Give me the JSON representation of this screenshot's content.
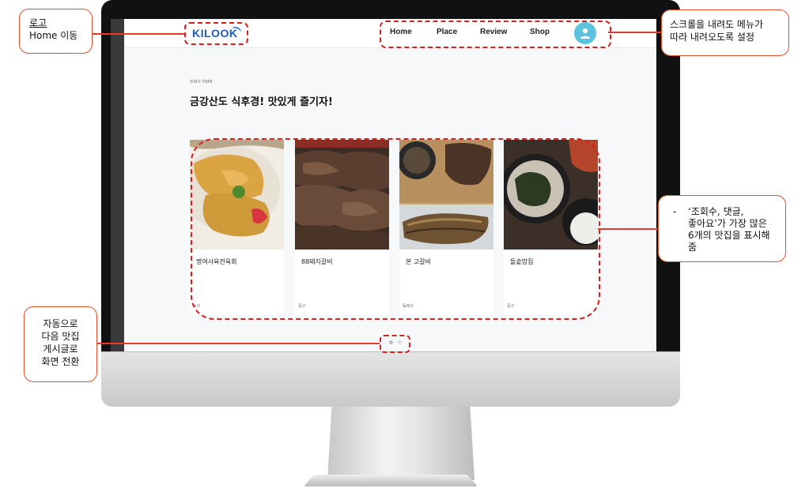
{
  "site": {
    "logo_text": "KILOOK",
    "nav_links": [
      "Home",
      "Place",
      "Review",
      "Shop"
    ]
  },
  "section": {
    "eyebrow": "조회수 TOP6",
    "title": "금강산도 식후경! 맛있게 즐기자!"
  },
  "cards": [
    {
      "name": "명여사육전육회",
      "location": "서구"
    },
    {
      "name": "88돼지갈비",
      "location": "중구"
    },
    {
      "name": "본 고갈비",
      "location": "동래구"
    },
    {
      "name": "돌솥밥집",
      "location": "중구"
    }
  ],
  "pagination": {
    "active_index": 0,
    "count": 2
  },
  "annotations": {
    "logo": {
      "line1": "로고",
      "line2": "Home 이동"
    },
    "menu": {
      "line1": "스크롤을 내려도 메뉴가",
      "line2": "따라 내려오도록 설정"
    },
    "cards": {
      "bullet": "-",
      "line1": "‘조회수, 댓글,",
      "line2": "좋아요’가 가장 많은",
      "line3": "6개의 맛집을 표시해",
      "line4": "줌"
    },
    "slider": {
      "line1": "자동으로",
      "line2": "다음 맛집",
      "line3": "게시글로",
      "line4": "화면 전환"
    }
  },
  "colors": {
    "annotation_border": "#e0512a",
    "dashed_highlight": "#d62020",
    "logo_blue": "#1e5bb8",
    "avatar_bg": "#5bc2e0"
  },
  "icons": {
    "avatar": "user-icon"
  }
}
